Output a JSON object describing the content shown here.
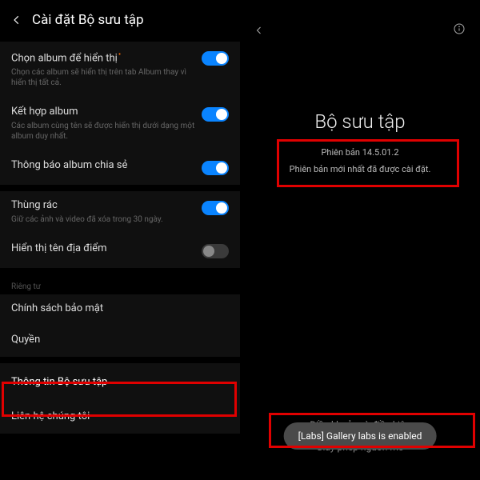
{
  "left": {
    "title": "Cài đặt Bộ sưu tập",
    "rows": {
      "chooseAlbums": {
        "title": "Chọn album để hiển thị",
        "sub": "Chọn các album sẽ hiển thị trên tab Album thay vì hiển thị tất cả."
      },
      "mergeAlbums": {
        "title": "Kết hợp album",
        "sub": "Các album cùng tên sẽ được hiển thị dưới dạng một album duy nhất."
      },
      "sharedNotif": {
        "title": "Thông báo album chia sẻ"
      },
      "trash": {
        "title": "Thùng rác",
        "sub": "Giữ các ảnh và video đã xóa trong 30 ngày."
      },
      "showLocation": {
        "title": "Hiển thị tên địa điểm"
      },
      "privacyLabel": "Riêng tư",
      "privacyPolicy": {
        "title": "Chính sách bảo mật"
      },
      "permissions": {
        "title": "Quyền"
      },
      "about": {
        "title": "Thông tin Bộ sưu tập"
      },
      "contact": {
        "title": "Liên hệ chúng tôi"
      }
    }
  },
  "right": {
    "appTitle": "Bộ sưu tập",
    "version": "Phiên bản 14.5.01.2",
    "status": "Phiên bản mới nhất đã được cài đặt.",
    "links": {
      "terms": "Điều khoản và điều kiện",
      "openSource": "Giấy phép nguồn mở"
    },
    "toast": "[Labs] Gallery labs is enabled"
  }
}
